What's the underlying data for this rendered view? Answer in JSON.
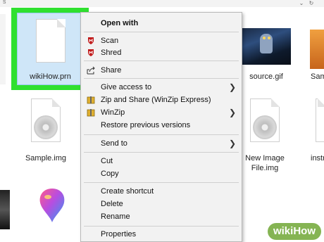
{
  "explorer": {
    "top_crumb": "s",
    "top_buttons": [
      "⌄",
      "↻"
    ],
    "files": {
      "selected": "wikiHow.prn",
      "source": "source.gif",
      "sam_right": "Sam",
      "sample_img": "Sample.img",
      "new_image": [
        "New Image",
        "File.img"
      ],
      "instr": "instr"
    }
  },
  "context_menu": {
    "items": [
      {
        "label": "Open with",
        "icon": "",
        "bold": true
      },
      {
        "label": "Scan",
        "icon": "mcafee-shield-icon"
      },
      {
        "label": "Shred",
        "icon": "mcafee-shield-icon"
      },
      {
        "label": "Share",
        "icon": "share-icon"
      },
      {
        "label": "Give access to",
        "icon": "",
        "submenu": true
      },
      {
        "label": "Zip and Share (WinZip Express)",
        "icon": "winzip-icon"
      },
      {
        "label": "WinZip",
        "icon": "winzip-icon",
        "submenu": true
      },
      {
        "label": "Restore previous versions",
        "icon": ""
      },
      {
        "label": "Send to",
        "icon": "",
        "submenu": true
      },
      {
        "label": "Cut",
        "icon": ""
      },
      {
        "label": "Copy",
        "icon": ""
      },
      {
        "label": "Create shortcut",
        "icon": ""
      },
      {
        "label": "Delete",
        "icon": ""
      },
      {
        "label": "Rename",
        "icon": ""
      },
      {
        "label": "Properties",
        "icon": ""
      }
    ]
  },
  "watermark": {
    "part1": "wiki",
    "part2": "How"
  },
  "colors": {
    "selection_outline": "#2fe02f",
    "selection_fill": "#cfe6f8",
    "menu_bg": "#f2f2f2",
    "mcafee_red": "#c01818",
    "watermark_green": "#7eb04a"
  }
}
